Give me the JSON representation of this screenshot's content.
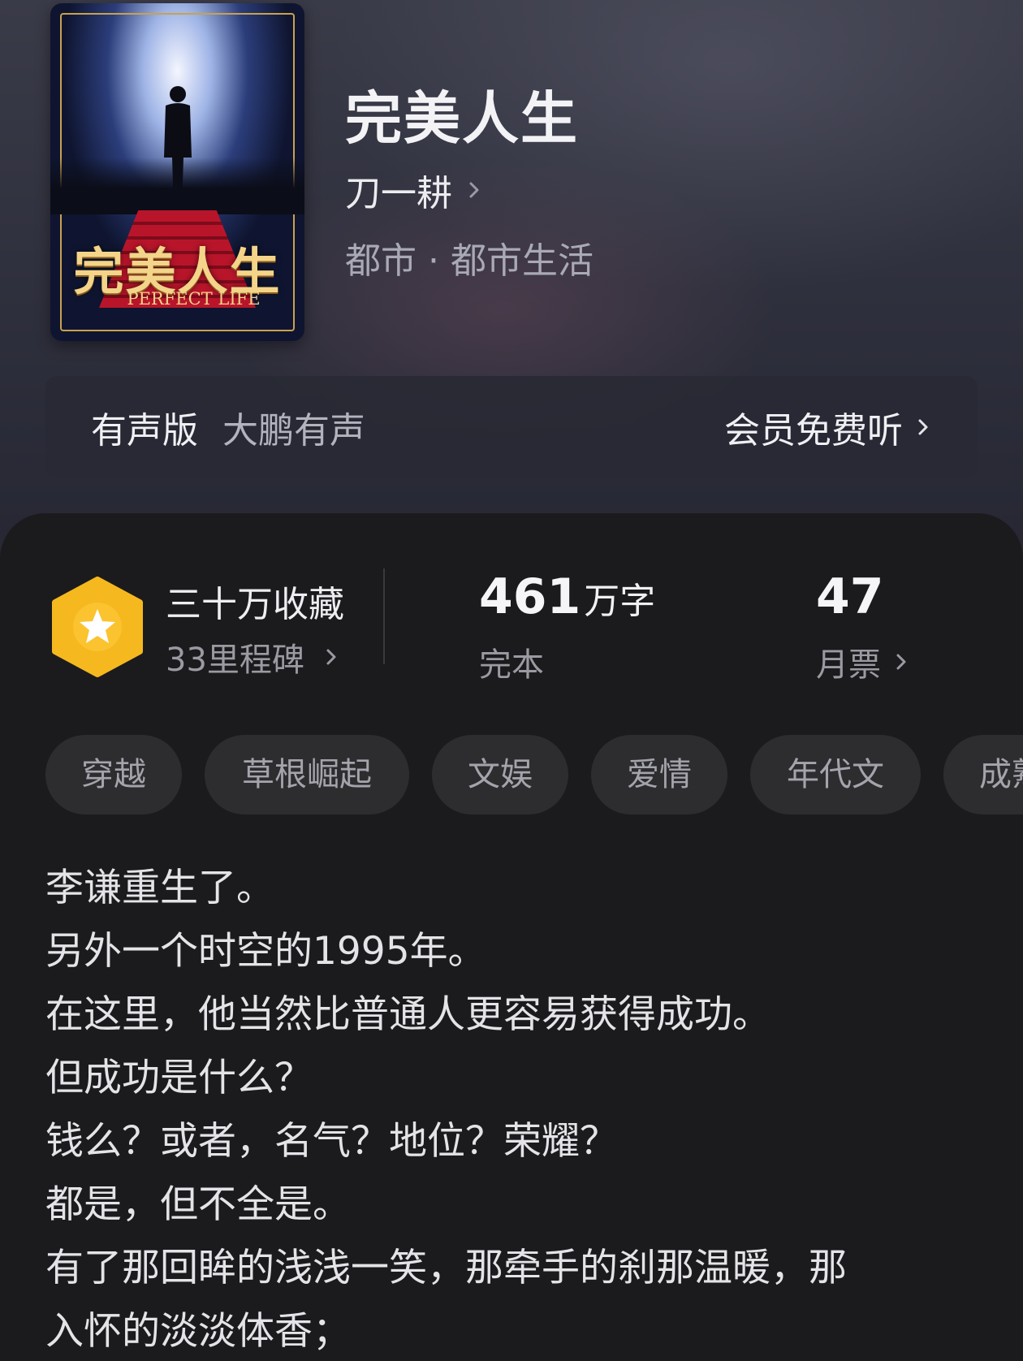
{
  "book": {
    "cover_title_cn": "完美人生",
    "cover_title_en": "PERFECT LIFE",
    "title": "完美人生",
    "author": "刀一耕",
    "genre": "都市 · 都市生活"
  },
  "audio": {
    "label": "有声版",
    "publisher": "大鹏有声",
    "link": "会员免费听"
  },
  "stats": {
    "favorites": "三十万收藏",
    "milestones": "33里程碑",
    "word_count": "461",
    "word_unit": "万字",
    "status": "完本",
    "monthly_votes": "47",
    "monthly_votes_label": "月票"
  },
  "tags": [
    "穿越",
    "草根崛起",
    "文娱",
    "爱情",
    "年代文",
    "成熟"
  ],
  "description": [
    "李谦重生了。",
    "另外一个时空的1995年。",
    "在这里，他当然比普通人更容易获得成功。",
    "但成功是什么？",
    "钱么？或者，名气？地位？荣耀？",
    "都是，但不全是。",
    "有了那回眸的浅浅一笑，那牵手的刹那温暖，那",
    "入怀的淡淡体香；"
  ],
  "colors": {
    "badge_gold": "#f6b81f",
    "panel_bg": "#1b1b1d",
    "tag_bg": "#2d2d30"
  }
}
